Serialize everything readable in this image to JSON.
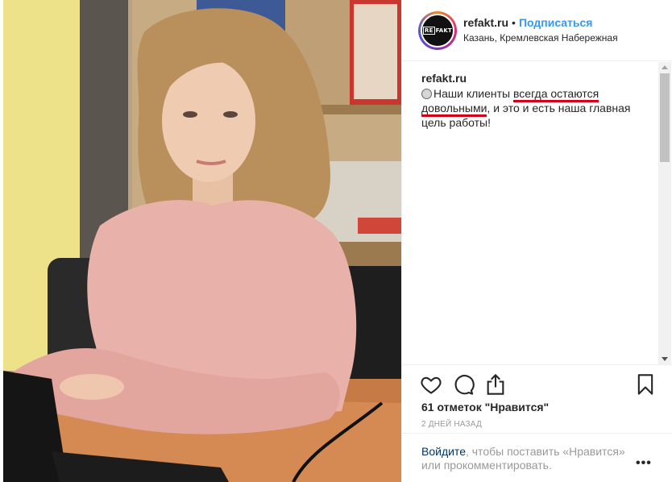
{
  "photo": {
    "description_icon": "photo-of-woman-at-laptop"
  },
  "header": {
    "username": "refakt.ru",
    "separator": "•",
    "follow_label": "Подписаться",
    "location": "Казань, Кремлевская Набережная",
    "avatar_logo": {
      "box_text": "RE",
      "rest_text": "FAKT"
    }
  },
  "caption": {
    "username": "refakt.ru",
    "part1": "Наши клиенты ",
    "highlight1": "всегда остаются",
    "line_break_space": " ",
    "highlight2": "довольными",
    "part2": ", и это и есть наша главная цель работы!"
  },
  "actions": {
    "like_icon": "heart-icon",
    "comment_icon": "comment-icon",
    "share_icon": "share-icon",
    "save_icon": "bookmark-icon",
    "likes_text": "61 отметок \"Нравится\"",
    "timestamp": "2 ДНЕЙ НАЗАД"
  },
  "login": {
    "link_text": "Войдите",
    "rest_text": ", чтобы поставить «Нравится» или прокомментировать.",
    "more_label": "•••"
  },
  "colors": {
    "link_blue": "#3897f0",
    "highlight_red": "#d4001a",
    "muted": "#999999",
    "text": "#262626"
  }
}
